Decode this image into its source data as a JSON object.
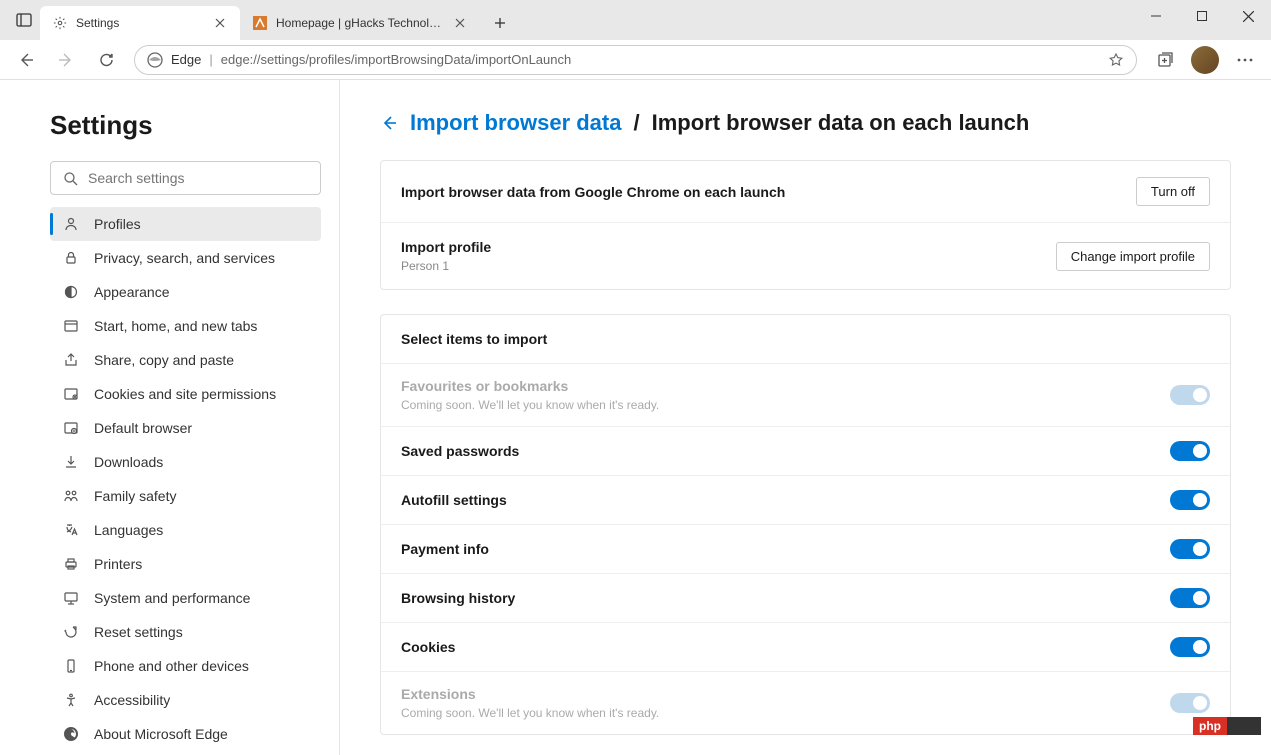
{
  "tabs": [
    {
      "title": "Settings"
    },
    {
      "title": "Homepage | gHacks Technology"
    }
  ],
  "toolbar": {
    "edge_label": "Edge",
    "url": "edge://settings/profiles/importBrowsingData/importOnLaunch"
  },
  "sidebar": {
    "title": "Settings",
    "search_placeholder": "Search settings",
    "items": [
      {
        "icon": "profiles",
        "label": "Profiles",
        "active": true
      },
      {
        "icon": "lock",
        "label": "Privacy, search, and services"
      },
      {
        "icon": "appearance",
        "label": "Appearance"
      },
      {
        "icon": "start",
        "label": "Start, home, and new tabs"
      },
      {
        "icon": "share",
        "label": "Share, copy and paste"
      },
      {
        "icon": "cookies",
        "label": "Cookies and site permissions"
      },
      {
        "icon": "browser",
        "label": "Default browser"
      },
      {
        "icon": "download",
        "label": "Downloads"
      },
      {
        "icon": "family",
        "label": "Family safety"
      },
      {
        "icon": "languages",
        "label": "Languages"
      },
      {
        "icon": "printers",
        "label": "Printers"
      },
      {
        "icon": "system",
        "label": "System and performance"
      },
      {
        "icon": "reset",
        "label": "Reset settings"
      },
      {
        "icon": "phone",
        "label": "Phone and other devices"
      },
      {
        "icon": "accessibility",
        "label": "Accessibility"
      },
      {
        "icon": "about",
        "label": "About Microsoft Edge"
      }
    ]
  },
  "breadcrumb": {
    "link": "Import browser data",
    "current": "Import browser data on each launch"
  },
  "card1": {
    "row1_title": "Import browser data from Google Chrome on each launch",
    "row1_btn": "Turn off",
    "row2_title": "Import profile",
    "row2_sub": "Person 1",
    "row2_btn": "Change import profile"
  },
  "import_section": {
    "header": "Select items to import",
    "items": [
      {
        "title": "Favourites or bookmarks",
        "desc": "Coming soon. We'll let you know when it's ready.",
        "disabled": true,
        "on": false
      },
      {
        "title": "Saved passwords",
        "on": true
      },
      {
        "title": "Autofill settings",
        "on": true
      },
      {
        "title": "Payment info",
        "on": true
      },
      {
        "title": "Browsing history",
        "on": true
      },
      {
        "title": "Cookies",
        "on": true
      },
      {
        "title": "Extensions",
        "desc": "Coming soon. We'll let you know when it's ready.",
        "disabled": true,
        "on": false
      }
    ]
  },
  "badge": {
    "text": "php"
  }
}
